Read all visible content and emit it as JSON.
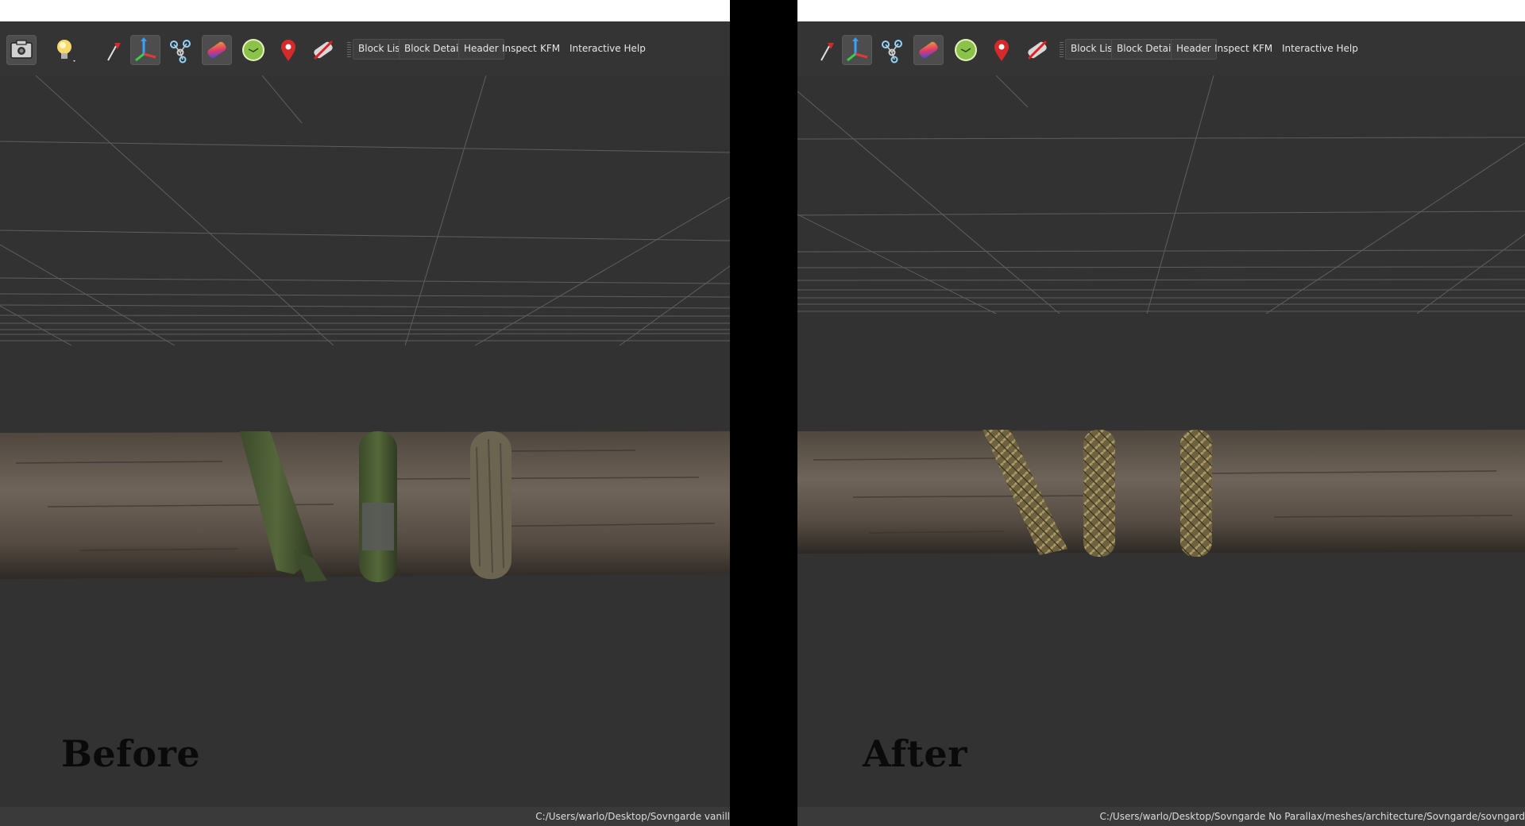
{
  "toolbar": {
    "menu": [
      "Block List",
      "Block Details",
      "Header",
      "Inspect",
      "KFM",
      "Interactive Help"
    ],
    "icons": [
      "screenshot-icon",
      "light-bulb-icon",
      "select-pin-icon",
      "axes-icon",
      "skeleton-nodes-icon",
      "texture-gradient-icon",
      "globe-icon",
      "location-pin-icon",
      "no-texture-icon"
    ]
  },
  "left": {
    "caption": "Before",
    "status_path": "C:/Users/warlo/Desktop/Sovngarde vanill"
  },
  "right": {
    "caption": "After",
    "status_path": "C:/Users/warlo/Desktop/Sovngarde No Parallax/meshes/architecture/Sovngarde/sovngard"
  },
  "colors": {
    "toolbar_bg": "#343434",
    "viewport_bg": "#323232",
    "divider": "#000000"
  }
}
